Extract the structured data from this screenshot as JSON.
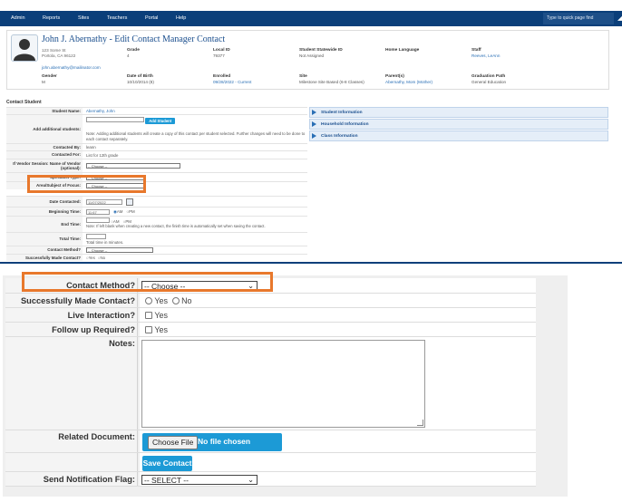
{
  "nav": {
    "items": [
      "Admin",
      "Reports",
      "Sites",
      "Teachers",
      "Portal",
      "Help"
    ],
    "quick_find_placeholder": "Type to quick page find"
  },
  "header": {
    "title": "John J. Abernathy - Edit Contact Manager Contact",
    "address_line1": "123 Some St",
    "address_line2": "Portola, CA 96122",
    "email": "john.abernathy@mailinator.com",
    "fields": {
      "grade_label": "Grade",
      "grade_value": "4",
      "local_id_label": "Local ID",
      "local_id_value": "79377",
      "statewide_label": "Student Statewide ID",
      "statewide_value": "Not Assigned",
      "home_lang_label": "Home Language",
      "home_lang_value": "",
      "staff_label": "Staff",
      "staff_value": "Reeves, LeAnn",
      "gender_label": "Gender",
      "gender_value": "M",
      "dob_label": "Date of Birth",
      "dob_value": "10/10/2014 (8)",
      "enrolled_label": "Enrolled",
      "enrolled_value": "09/28/2022 - Current",
      "site_label": "Site",
      "site_value": "Milestone Site Based (6-8 Classes)",
      "parents_label": "Parent(s)",
      "parents_value": "Abernathy, Mom (Mother)",
      "grad_label": "Graduation Path",
      "grad_value": "General Education"
    }
  },
  "contact_student": {
    "section_title": "Contact Student",
    "student_name_label": "Student Name:",
    "student_name_value": "Abernathy, John",
    "add_students_label": "Add additional students:",
    "add_student_button": "Add Student",
    "add_students_note": "Note: Adding additional students will create a copy of this contact per student selected. Further changes will need to be done to each contact separately.",
    "contacted_by_label": "Contacted By:",
    "contacted_by_value": "leann",
    "contacted_for_label": "Contacted For:",
    "contacted_for_value": "List for 12th grade",
    "vendor_label": "If Vendor Session: Name of Vendor (optional):",
    "vendor_value": "-- Choose --",
    "specialist_label": "Specialist Type:",
    "specialist_value": "-- Choose --",
    "area_label": "Area/Subject of Focus:",
    "area_value": "-- Choose --",
    "date_label": "Date Contacted:",
    "date_value": "11/07/2022",
    "begin_label": "Beginning Time:",
    "begin_value": "11:67",
    "am": "AM",
    "pm": "PM",
    "end_label": "End Time:",
    "end_note": "Note: If left blank when creating a new contact, the finish time is automatically set when saving the contact.",
    "total_label": "Total Time:",
    "total_note": "Total time in minutes.",
    "method_label": "Contact Method?",
    "method_value": "-- Choose --",
    "success_label": "Successfully Made Contact?",
    "yes": "Yes",
    "no": "No"
  },
  "accordions": [
    "Student Information",
    "Household Information",
    "Class Information"
  ],
  "lower_form": {
    "contact_method_label": "Contact Method?",
    "contact_method_value": "-- Choose --",
    "success_label": "Successfully Made Contact?",
    "yes": "Yes",
    "no": "No",
    "live_label": "Live Interaction?",
    "live_option": "Yes",
    "followup_label": "Follow up Required?",
    "followup_option": "Yes",
    "notes_label": "Notes:",
    "related_label": "Related Document:",
    "choose_file": "Choose File",
    "no_file": "No file chosen",
    "save_button": "Save Contact",
    "notify_label": "Send Notification Flag:",
    "notify_value": "-- SELECT --"
  },
  "colors": {
    "nav_bg": "#0b3f7a",
    "accent": "#1c9ad6",
    "highlight": "#e8782c",
    "link": "#2a6fb5"
  }
}
